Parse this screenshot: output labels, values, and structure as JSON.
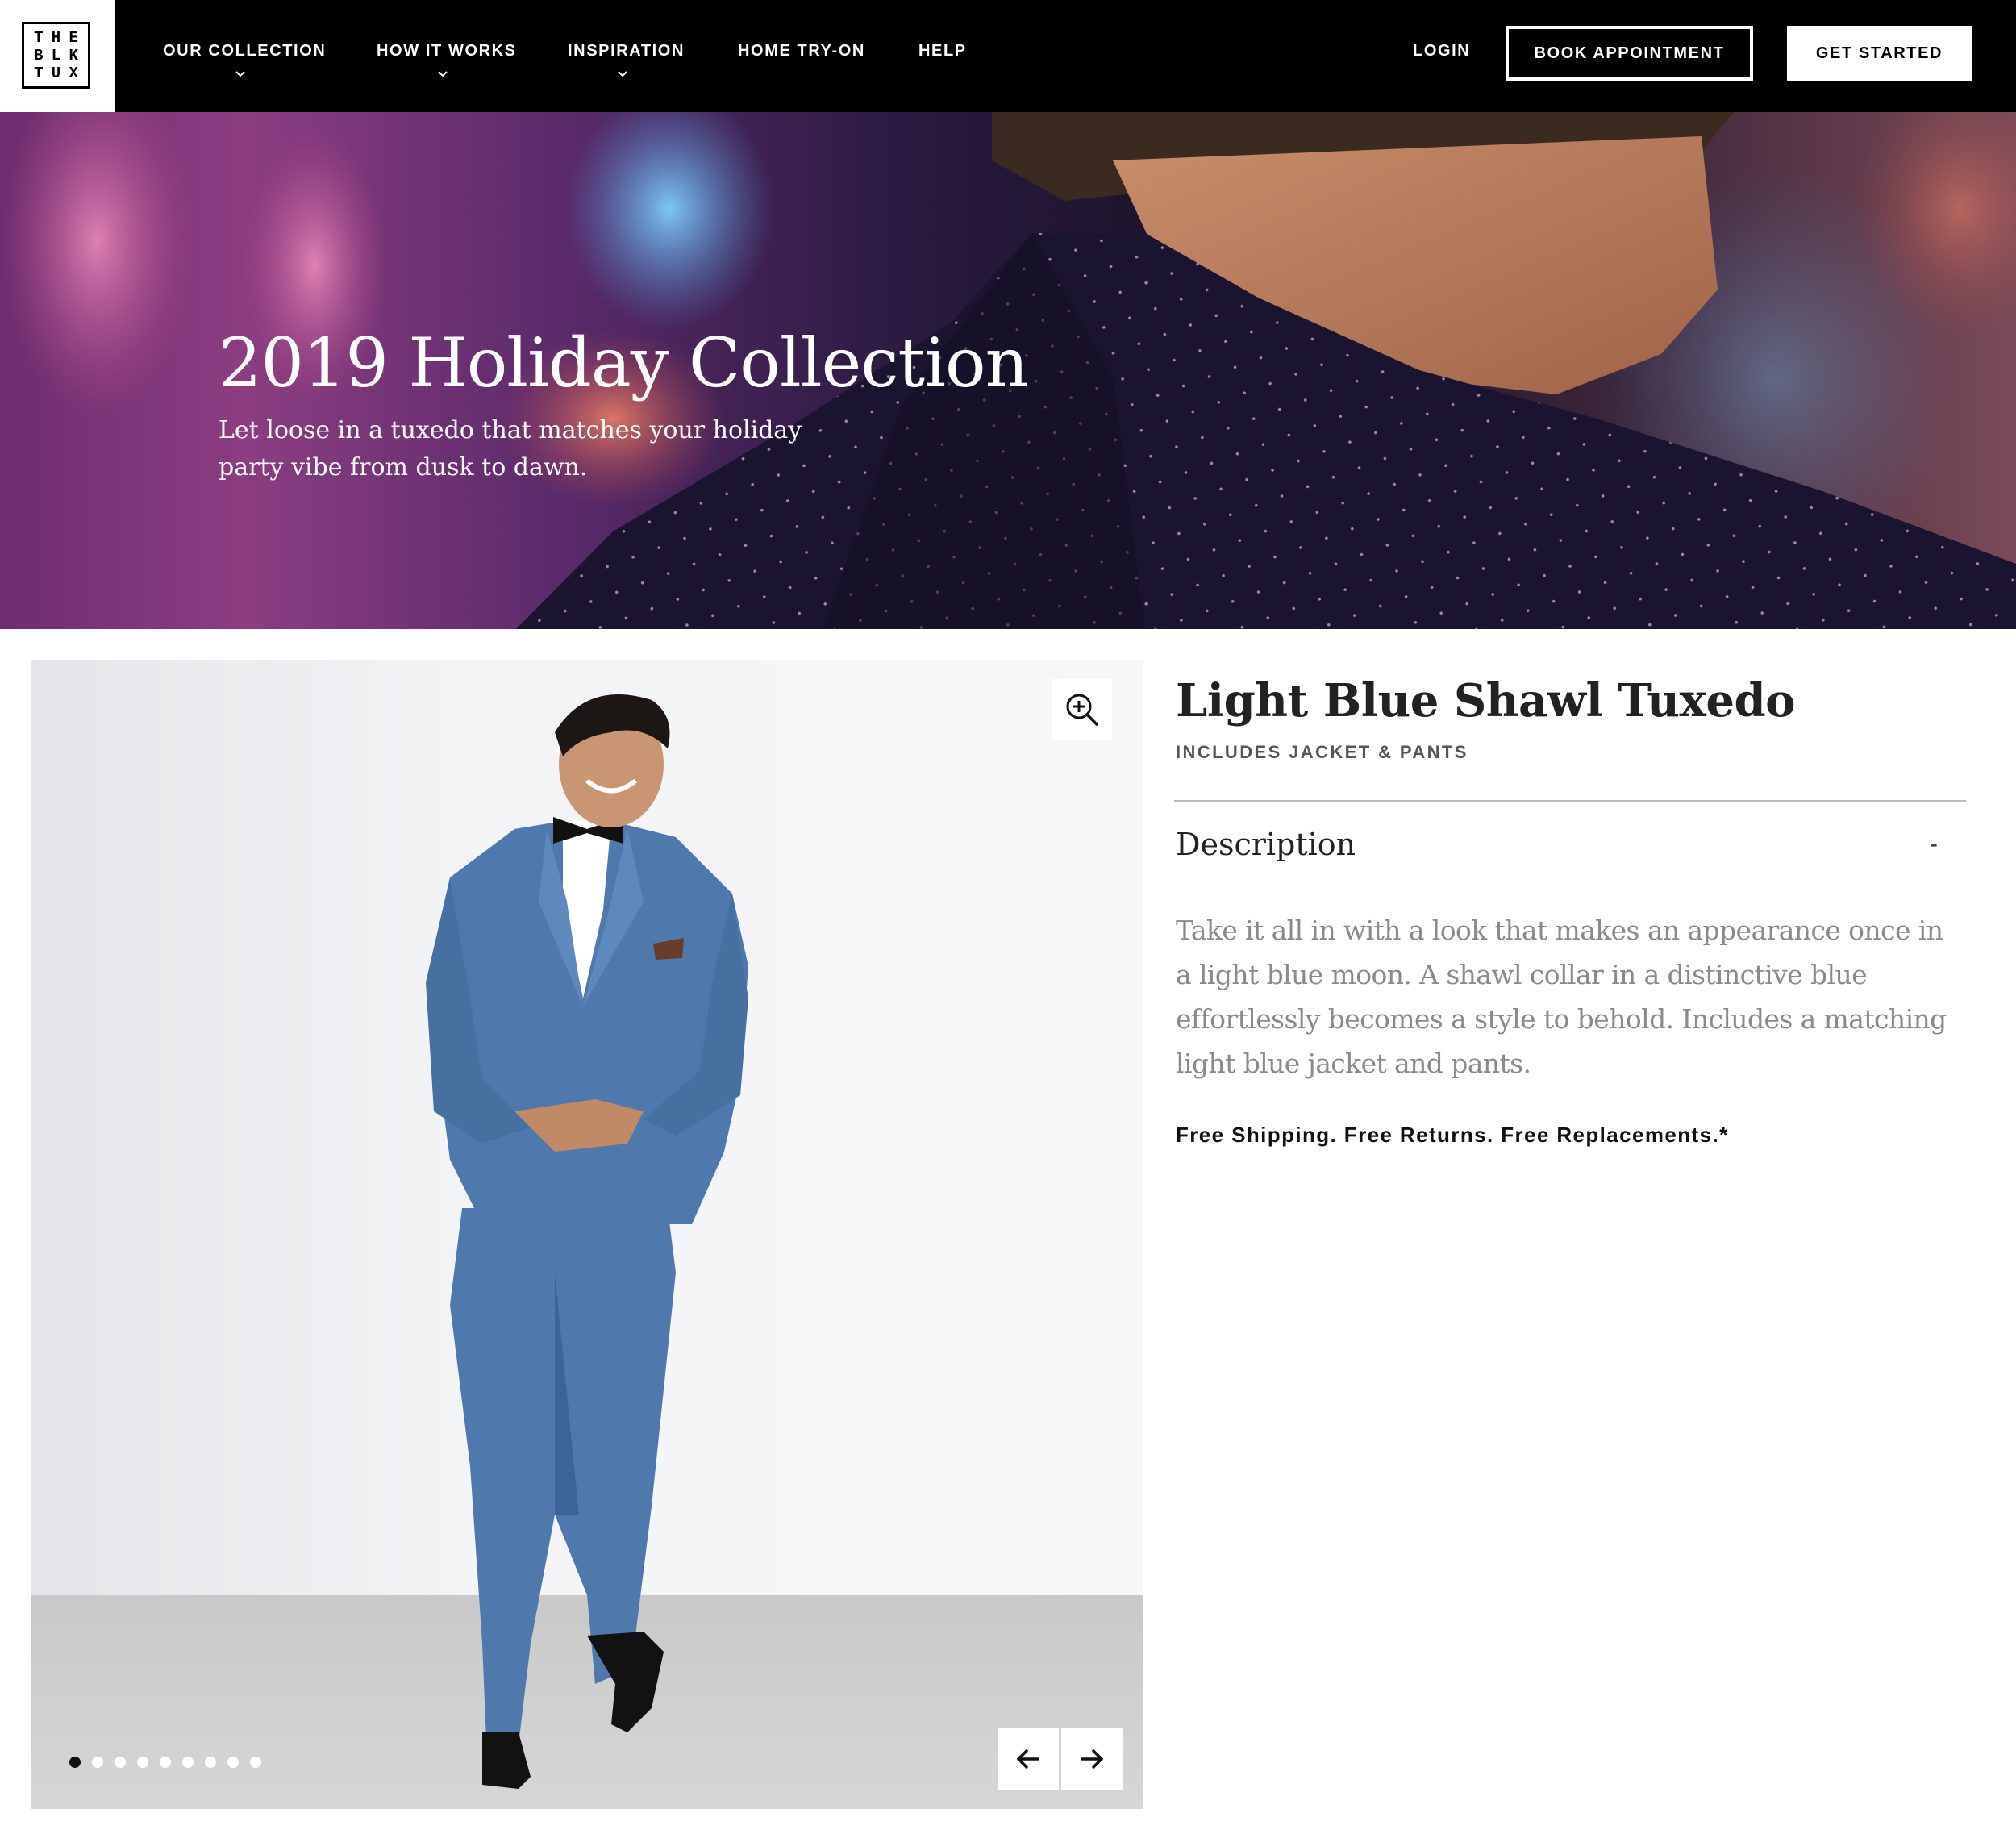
{
  "brand": {
    "logo_letters": [
      "T",
      "H",
      "E",
      "B",
      "L",
      "K",
      "T",
      "U",
      "X"
    ]
  },
  "nav": {
    "items": [
      {
        "label": "OUR COLLECTION",
        "has_dropdown": true
      },
      {
        "label": "HOW IT WORKS",
        "has_dropdown": true
      },
      {
        "label": "INSPIRATION",
        "has_dropdown": true
      },
      {
        "label": "HOME TRY-ON",
        "has_dropdown": false
      },
      {
        "label": "HELP",
        "has_dropdown": false
      }
    ],
    "login": "LOGIN",
    "book_appointment": "BOOK APPOINTMENT",
    "get_started": "GET STARTED"
  },
  "hero": {
    "title": "2019 Holiday Collection",
    "subtitle_line1": "Let loose in a tuxedo that matches your holiday",
    "subtitle_line2": "party vibe from dusk to dawn."
  },
  "gallery": {
    "zoom_icon": "zoom-in-icon",
    "slide_count": 9,
    "active_slide": 1,
    "prev_icon": "arrow-left-icon",
    "next_icon": "arrow-right-icon"
  },
  "product": {
    "title": "Light Blue Shawl Tuxedo",
    "includes": "INCLUDES JACKET & PANTS",
    "description_heading": "Description",
    "description_toggle": "-",
    "description_lines": [
      "Take it all in with a look that makes an appearance once in",
      "a light blue moon. A shawl collar in a distinctive blue",
      "effortlessly becomes a style to behold. Includes a matching",
      "light blue jacket and pants."
    ],
    "shipping_note": "Free Shipping. Free Returns. Free Replacements.*"
  },
  "colors": {
    "nav_bg": "#000000",
    "suit_blue": "#4f79ad",
    "description_text": "#8a8a8a"
  }
}
